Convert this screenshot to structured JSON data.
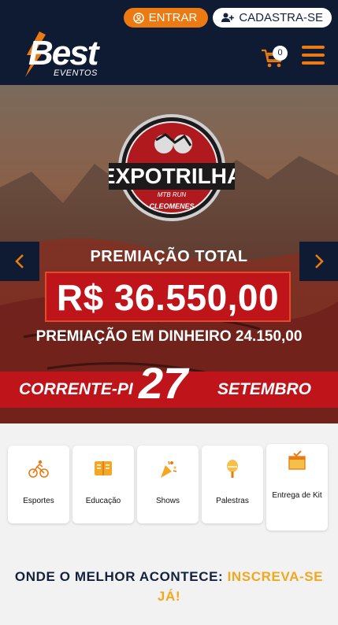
{
  "header": {
    "login_label": "ENTRAR",
    "register_label": "CADASTRA-SE",
    "logo_text": "Best",
    "logo_sub": "EVENTOS",
    "cart_count": "0",
    "colors": {
      "bg": "#0f1a33",
      "accent": "#ec7a12"
    }
  },
  "banner": {
    "event_logo_text": "EXPOTRILHA",
    "event_logo_sub": "MTB RUN",
    "event_logo_sub2": "CLEOMENES",
    "prize_title": "PREMIAÇÃO TOTAL",
    "prize_value": "R$ 36.550,00",
    "prize_cash": "PREMIAÇÃO EM DINHEIRO 24.150,00",
    "city": "CORRENTE-PI",
    "day": "27",
    "month": "SETEMBRO"
  },
  "categories": [
    {
      "label": "Esportes",
      "icon": "cyclist-icon"
    },
    {
      "label": "Educação",
      "icon": "book-icon"
    },
    {
      "label": "Shows",
      "icon": "party-icon"
    },
    {
      "label": "Palestras",
      "icon": "microphone-icon"
    },
    {
      "label": "Entrega de Kit",
      "icon": "package-icon"
    }
  ],
  "tagline": {
    "main": "ONDE O MELHOR ACONTECE: ",
    "highlight": "INSCREVA-SE JÁ!"
  }
}
